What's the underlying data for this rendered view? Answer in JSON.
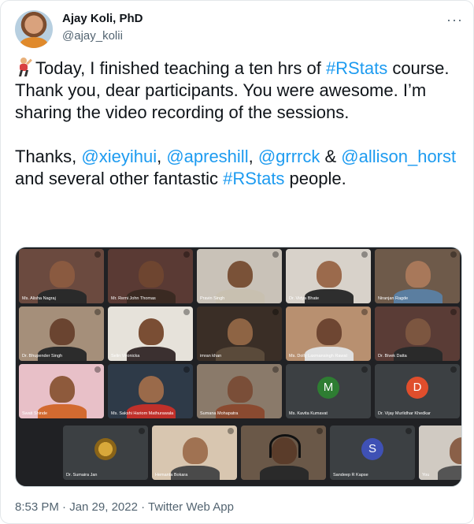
{
  "author": {
    "name": "Ajay Koli, PhD",
    "handle": "@ajay_kolii"
  },
  "tweet": {
    "lines": [
      [
        {
          "t": "Today, I finished teaching a ten hrs of "
        },
        {
          "t": "#RStats",
          "link": true
        },
        {
          "t": " course. Thank you, dear participants. You were awesome. I’m sharing the video recording of the sessions."
        }
      ],
      [
        {
          "t": "Thanks, "
        },
        {
          "t": "@xieyihui",
          "link": true
        },
        {
          "t": ",  "
        },
        {
          "t": "@apreshill",
          "link": true
        },
        {
          "t": ", "
        },
        {
          "t": "@grrrck",
          "link": true
        },
        {
          "t": " & "
        },
        {
          "t": "@allison_horst",
          "link": true
        },
        {
          "t": " and several other fantastic "
        },
        {
          "t": "#RStats",
          "link": true
        },
        {
          "t": " people."
        }
      ]
    ],
    "link_color": "#1d9bf0"
  },
  "video_grid": {
    "rows": [
      [
        {
          "label": "Ms. Alisha Nagraj",
          "bg": "#6b4a3f",
          "skin": "#8a5a40",
          "shirt": "#2a2a2a"
        },
        {
          "label": "Mr. Remi John Thomas",
          "bg": "#5a3a34",
          "skin": "#6e4530",
          "shirt": "#3a2a22"
        },
        {
          "label": "Pravin Singh",
          "bg": "#c9c2b8",
          "skin": "#7a5238",
          "shirt": "#c8c0b0"
        },
        {
          "label": "Dr. Vidya Bhate",
          "bg": "#d8d2ca",
          "skin": "#9b6a4c",
          "shirt": "#2e2e2e"
        },
        {
          "label": "Niranjan Ragde",
          "bg": "#6e5a4a",
          "skin": "#a8785a",
          "shirt": "#5b7ea0"
        }
      ],
      [
        {
          "label": "Dr. Bhupender Singh",
          "bg": "#a58f7a",
          "skin": "#6a4430",
          "shirt": "#2c2c2c"
        },
        {
          "label": "Selin Vironicka",
          "bg": "#e6e2da",
          "skin": "#7a4e34",
          "shirt": "#3b3030"
        },
        {
          "label": "imran khan",
          "bg": "#3a2e26",
          "skin": "#8e6444",
          "shirt": "#5a4a3a"
        },
        {
          "label": "Ms. Dolly Laxmansingh Rawat",
          "bg": "#b89070",
          "skin": "#6e4632",
          "shirt": "#e0e0e0"
        },
        {
          "label": "Dr. Bivek Datta",
          "bg": "#5a3c36",
          "skin": "#7c5640",
          "shirt": "#2a2a2a"
        }
      ],
      [
        {
          "label": "Swati Shinde",
          "bg": "#e8c0c8",
          "skin": "#8e5a3c",
          "shirt": "#d26a30"
        },
        {
          "label": "Ms. Sakshi Hariom Mathurawala",
          "bg": "#2e3a48",
          "skin": "#9a6a4a",
          "shirt": "#c0302a"
        },
        {
          "label": "Sumana Mohapatra",
          "bg": "#8a7a6a",
          "skin": "#7a4e38",
          "shirt": "#8a4a30"
        },
        {
          "label": "Ms. Kavita Kumavat",
          "initial": "M",
          "circle": "#2e7d32"
        },
        {
          "label": "Dr. Vijay Murlidhar Khedkar",
          "initial": "D",
          "circle": "#e04e2c"
        }
      ],
      [
        {
          "label": "Dr. Sumaira Jan",
          "medal": true
        },
        {
          "label": "Hemanta Bokara",
          "bg": "#d8c6b0",
          "skin": "#a07252",
          "shirt": "#4a4a4a"
        },
        {
          "label": "",
          "bg": "#6a5848",
          "skin": "#5a3c2a",
          "shirt": "#2a2a2a",
          "headphones": true
        },
        {
          "label": "Sandeep R Kapse",
          "initial": "S",
          "circle": "#3f51b5"
        },
        {
          "label": "You",
          "bg": "#d0cac2",
          "skin": "#8a6048",
          "shirt": "#555555",
          "active": true
        }
      ]
    ]
  },
  "meta": "8:53 PM · Jan 29, 2022 · Twitter Web App"
}
